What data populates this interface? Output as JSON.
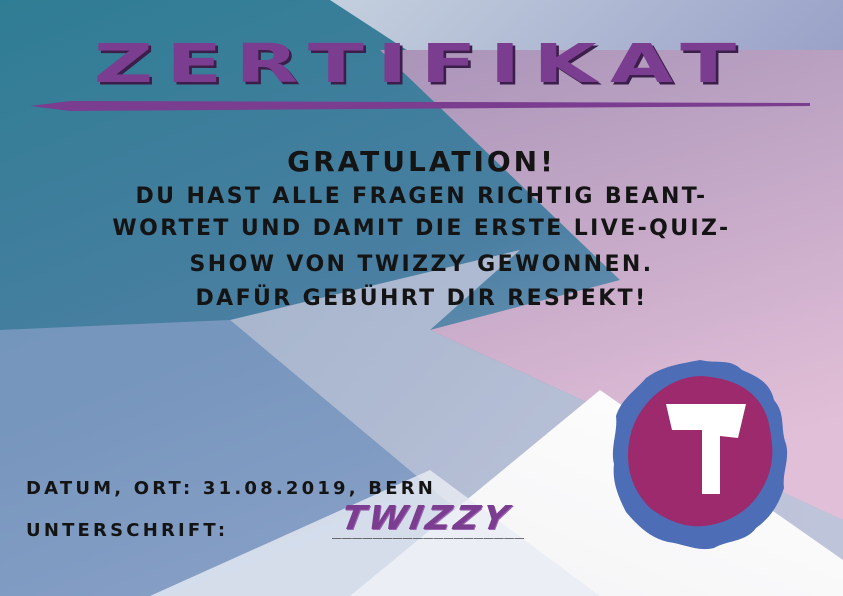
{
  "certificate": {
    "title": "ZERTIFIKAT",
    "greeting": "GRATULATION!",
    "body_lines": [
      "DU HAST ALLE FRAGEN RICHTIG BEANT-",
      "WORTET UND DAMIT DIE ERSTE LIVE-QUIZ-",
      "SHOW VON TWIZZY GEWONNEN.",
      "DAFÜR GEBÜHRT DIR RESPEKT!"
    ],
    "date_line": "DATUM, ORT: 31.08.2019, BERN",
    "signature_label": "UNTERSCHRIFT:",
    "signature_blank": "___________________",
    "signature": "TWIZZY",
    "logo_letter": "T"
  },
  "colors": {
    "title": "#7a3d8f",
    "text": "#141414",
    "logo_ring": "#4d6db7",
    "logo_fill": "#9c2a6c",
    "bg_teal": "#3f8199",
    "bg_pink": "#c9a2c2",
    "bg_slate": "#a9b3cc"
  }
}
